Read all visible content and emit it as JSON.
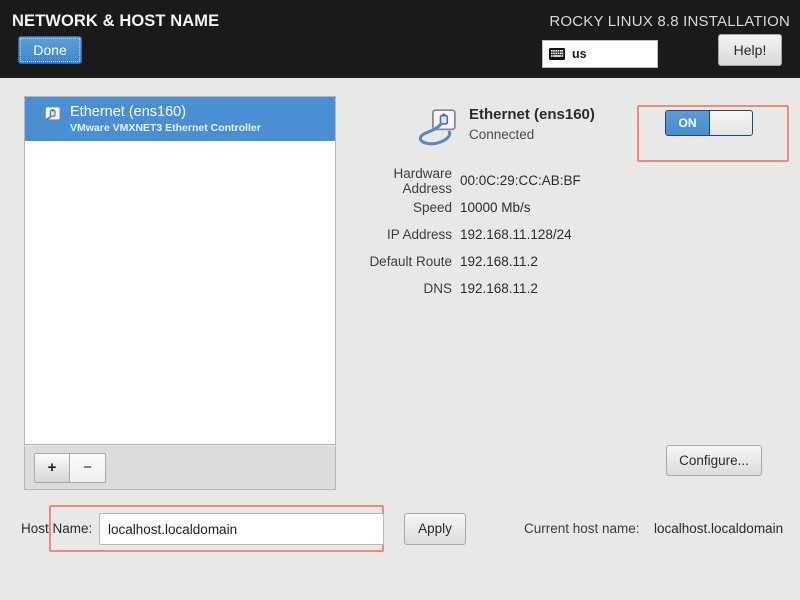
{
  "header": {
    "title": "NETWORK & HOST NAME",
    "product": "ROCKY LINUX 8.8 INSTALLATION",
    "done_label": "Done",
    "help_label": "Help!",
    "keyboard_layout": "us",
    "keyboard_icon": "keyboard-icon"
  },
  "device_list": {
    "items": [
      {
        "name": "Ethernet (ens160)",
        "description": "VMware VMXNET3 Ethernet Controller",
        "icon": "wired-network-icon",
        "selected": true
      }
    ],
    "add_label": "+",
    "remove_label": "−"
  },
  "details": {
    "icon": "wired-network-icon",
    "title": "Ethernet (ens160)",
    "state": "Connected",
    "rows": [
      {
        "label": "Hardware Address",
        "value": "00:0C:29:CC:AB:BF"
      },
      {
        "label": "Speed",
        "value": "10000 Mb/s"
      },
      {
        "label": "IP Address",
        "value": "192.168.11.128/24"
      },
      {
        "label": "Default Route",
        "value": "192.168.11.2"
      },
      {
        "label": "DNS",
        "value": "192.168.11.2"
      }
    ],
    "configure_label": "Configure..."
  },
  "toggle": {
    "on_label": "ON",
    "state": "on",
    "highlight_color": "#ef8a80"
  },
  "hostname": {
    "label": "Host Name:",
    "value": "localhost.localdomain",
    "placeholder": "",
    "apply_label": "Apply",
    "current_label": "Current host name:",
    "current_value": "localhost.localdomain",
    "highlight_color": "#ef8a80"
  },
  "colors": {
    "header_bg": "#1a1a1c",
    "page_bg": "#e8e8e6",
    "accent_blue": "#4a8fd4",
    "highlight_red": "#ef8a80"
  }
}
